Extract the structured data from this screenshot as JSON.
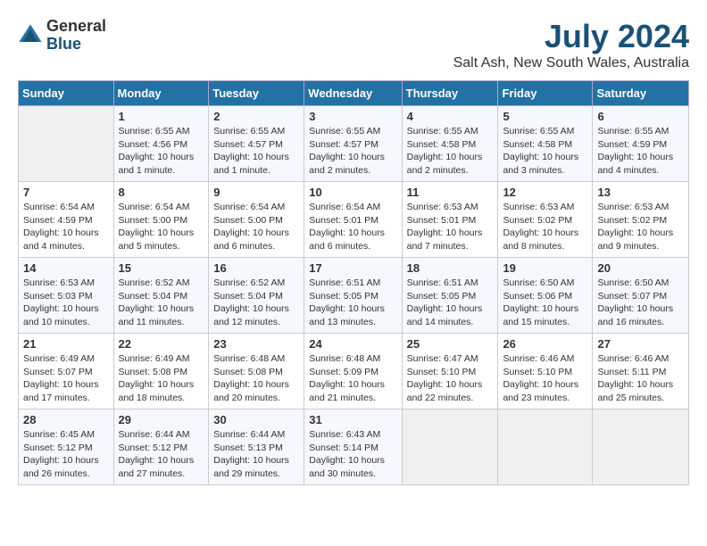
{
  "logo": {
    "general": "General",
    "blue": "Blue"
  },
  "title": "July 2024",
  "location": "Salt Ash, New South Wales, Australia",
  "days_header": [
    "Sunday",
    "Monday",
    "Tuesday",
    "Wednesday",
    "Thursday",
    "Friday",
    "Saturday"
  ],
  "weeks": [
    [
      {
        "num": "",
        "info": ""
      },
      {
        "num": "1",
        "info": "Sunrise: 6:55 AM\nSunset: 4:56 PM\nDaylight: 10 hours\nand 1 minute."
      },
      {
        "num": "2",
        "info": "Sunrise: 6:55 AM\nSunset: 4:57 PM\nDaylight: 10 hours\nand 1 minute."
      },
      {
        "num": "3",
        "info": "Sunrise: 6:55 AM\nSunset: 4:57 PM\nDaylight: 10 hours\nand 2 minutes."
      },
      {
        "num": "4",
        "info": "Sunrise: 6:55 AM\nSunset: 4:58 PM\nDaylight: 10 hours\nand 2 minutes."
      },
      {
        "num": "5",
        "info": "Sunrise: 6:55 AM\nSunset: 4:58 PM\nDaylight: 10 hours\nand 3 minutes."
      },
      {
        "num": "6",
        "info": "Sunrise: 6:55 AM\nSunset: 4:59 PM\nDaylight: 10 hours\nand 4 minutes."
      }
    ],
    [
      {
        "num": "7",
        "info": "Sunrise: 6:54 AM\nSunset: 4:59 PM\nDaylight: 10 hours\nand 4 minutes."
      },
      {
        "num": "8",
        "info": "Sunrise: 6:54 AM\nSunset: 5:00 PM\nDaylight: 10 hours\nand 5 minutes."
      },
      {
        "num": "9",
        "info": "Sunrise: 6:54 AM\nSunset: 5:00 PM\nDaylight: 10 hours\nand 6 minutes."
      },
      {
        "num": "10",
        "info": "Sunrise: 6:54 AM\nSunset: 5:01 PM\nDaylight: 10 hours\nand 6 minutes."
      },
      {
        "num": "11",
        "info": "Sunrise: 6:53 AM\nSunset: 5:01 PM\nDaylight: 10 hours\nand 7 minutes."
      },
      {
        "num": "12",
        "info": "Sunrise: 6:53 AM\nSunset: 5:02 PM\nDaylight: 10 hours\nand 8 minutes."
      },
      {
        "num": "13",
        "info": "Sunrise: 6:53 AM\nSunset: 5:02 PM\nDaylight: 10 hours\nand 9 minutes."
      }
    ],
    [
      {
        "num": "14",
        "info": "Sunrise: 6:53 AM\nSunset: 5:03 PM\nDaylight: 10 hours\nand 10 minutes."
      },
      {
        "num": "15",
        "info": "Sunrise: 6:52 AM\nSunset: 5:04 PM\nDaylight: 10 hours\nand 11 minutes."
      },
      {
        "num": "16",
        "info": "Sunrise: 6:52 AM\nSunset: 5:04 PM\nDaylight: 10 hours\nand 12 minutes."
      },
      {
        "num": "17",
        "info": "Sunrise: 6:51 AM\nSunset: 5:05 PM\nDaylight: 10 hours\nand 13 minutes."
      },
      {
        "num": "18",
        "info": "Sunrise: 6:51 AM\nSunset: 5:05 PM\nDaylight: 10 hours\nand 14 minutes."
      },
      {
        "num": "19",
        "info": "Sunrise: 6:50 AM\nSunset: 5:06 PM\nDaylight: 10 hours\nand 15 minutes."
      },
      {
        "num": "20",
        "info": "Sunrise: 6:50 AM\nSunset: 5:07 PM\nDaylight: 10 hours\nand 16 minutes."
      }
    ],
    [
      {
        "num": "21",
        "info": "Sunrise: 6:49 AM\nSunset: 5:07 PM\nDaylight: 10 hours\nand 17 minutes."
      },
      {
        "num": "22",
        "info": "Sunrise: 6:49 AM\nSunset: 5:08 PM\nDaylight: 10 hours\nand 18 minutes."
      },
      {
        "num": "23",
        "info": "Sunrise: 6:48 AM\nSunset: 5:08 PM\nDaylight: 10 hours\nand 20 minutes."
      },
      {
        "num": "24",
        "info": "Sunrise: 6:48 AM\nSunset: 5:09 PM\nDaylight: 10 hours\nand 21 minutes."
      },
      {
        "num": "25",
        "info": "Sunrise: 6:47 AM\nSunset: 5:10 PM\nDaylight: 10 hours\nand 22 minutes."
      },
      {
        "num": "26",
        "info": "Sunrise: 6:46 AM\nSunset: 5:10 PM\nDaylight: 10 hours\nand 23 minutes."
      },
      {
        "num": "27",
        "info": "Sunrise: 6:46 AM\nSunset: 5:11 PM\nDaylight: 10 hours\nand 25 minutes."
      }
    ],
    [
      {
        "num": "28",
        "info": "Sunrise: 6:45 AM\nSunset: 5:12 PM\nDaylight: 10 hours\nand 26 minutes."
      },
      {
        "num": "29",
        "info": "Sunrise: 6:44 AM\nSunset: 5:12 PM\nDaylight: 10 hours\nand 27 minutes."
      },
      {
        "num": "30",
        "info": "Sunrise: 6:44 AM\nSunset: 5:13 PM\nDaylight: 10 hours\nand 29 minutes."
      },
      {
        "num": "31",
        "info": "Sunrise: 6:43 AM\nSunset: 5:14 PM\nDaylight: 10 hours\nand 30 minutes."
      },
      {
        "num": "",
        "info": ""
      },
      {
        "num": "",
        "info": ""
      },
      {
        "num": "",
        "info": ""
      }
    ]
  ]
}
